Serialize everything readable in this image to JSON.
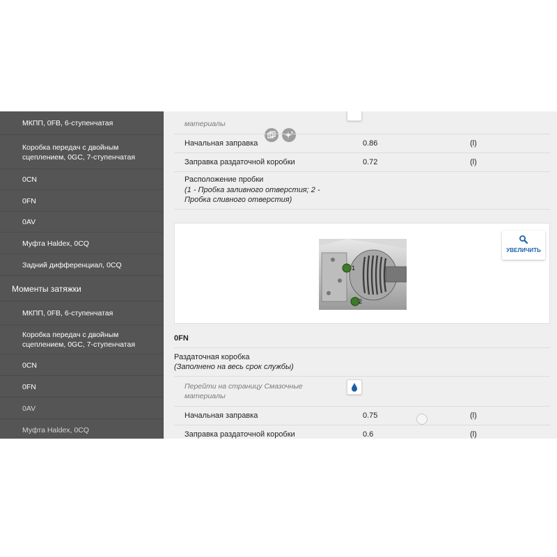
{
  "sidebar": {
    "items": [
      {
        "label": "МКПП, 0FB, 6-ступенчатая",
        "type": "item"
      },
      {
        "label": "Коробка передач с двойным сцеплением, 0GC, 7-ступенчатая",
        "type": "item"
      },
      {
        "label": "0CN",
        "type": "item"
      },
      {
        "label": "0FN",
        "type": "item"
      },
      {
        "label": "0AV",
        "type": "item"
      },
      {
        "label": "Муфта Haldex, 0CQ",
        "type": "item"
      },
      {
        "label": "Задний дифференциал, 0CQ",
        "type": "item"
      },
      {
        "label": "Моменты затяжки",
        "type": "section"
      },
      {
        "label": "МКПП, 0FB, 6-ступенчатая",
        "type": "item"
      },
      {
        "label": "Коробка передач с двойным сцеплением, 0GC, 7-ступенчатая",
        "type": "item"
      },
      {
        "label": "0CN",
        "type": "item"
      },
      {
        "label": "0FN",
        "type": "item"
      },
      {
        "label": "0AV",
        "type": "item"
      },
      {
        "label": "Муфта Haldex, 0CQ",
        "type": "item"
      }
    ]
  },
  "content": {
    "top_partial_label": "материалы",
    "rows_top": [
      {
        "name": "Начальная заправка",
        "value": "0.86",
        "unit": "(l)"
      },
      {
        "name": "Заправка раздаточной коробки",
        "value": "0.72",
        "unit": "(l)"
      }
    ],
    "plug_location": {
      "title": "Расположение пробки",
      "note": "(1 - Пробка заливного отверстия; 2 - Пробка сливного отверстия)"
    },
    "zoom_label": "УВЕЛИЧИТЬ",
    "diagram_labels": {
      "one": "1",
      "two": "2"
    },
    "section_0fn": {
      "heading": "0FN",
      "title": "Раздаточная коробка",
      "subtitle": "(Заполнено на весь срок службы)",
      "lubricants_link": "Перейти на страницу Смазочные материалы",
      "rows": [
        {
          "name": "Начальная заправка",
          "value": "0.75",
          "unit": "(l)"
        },
        {
          "name": "Заправка раздаточной коробки",
          "value": "0.6",
          "unit": "(l)"
        }
      ]
    }
  }
}
